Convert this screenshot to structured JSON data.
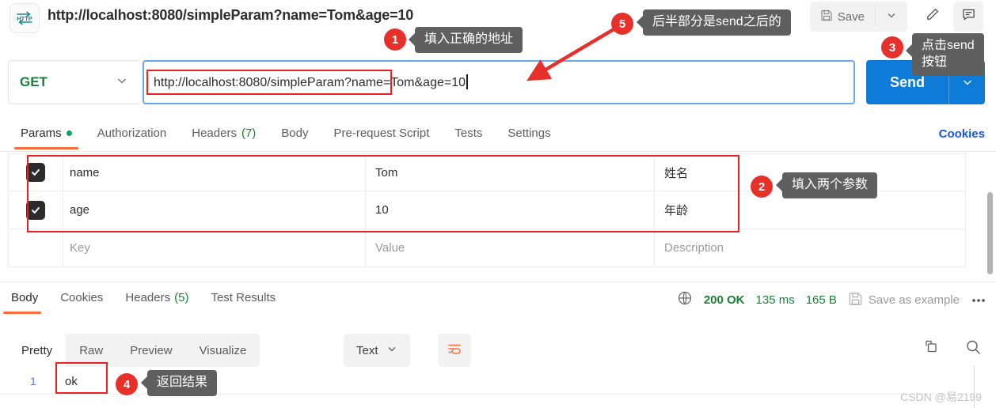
{
  "titlebar": {
    "logo_icon": "http-icon",
    "tab_title": "http://localhost:8080/simpleParam?name=Tom&age=10",
    "save_label": "Save",
    "save_icon": "floppy-disk-icon",
    "save_caret_icon": "chevron-down-icon",
    "pencil_icon": "pencil-icon",
    "comment_icon": "comment-icon"
  },
  "request": {
    "method": "GET",
    "method_caret_icon": "chevron-down-icon",
    "url": "http://localhost:8080/simpleParam?name=Tom&age=10",
    "url_highlight": "http://localhost:8080/simpleParam",
    "send_label": "Send",
    "send_caret_icon": "chevron-down-icon"
  },
  "request_tabs": {
    "items": [
      {
        "label": "Params",
        "active": true,
        "dot": true
      },
      {
        "label": "Authorization",
        "active": false
      },
      {
        "label": "Headers",
        "active": false,
        "count": "(7)"
      },
      {
        "label": "Body",
        "active": false
      },
      {
        "label": "Pre-request Script",
        "active": false
      },
      {
        "label": "Tests",
        "active": false
      },
      {
        "label": "Settings",
        "active": false
      }
    ],
    "cookies_link": "Cookies"
  },
  "params_table": {
    "headers": {
      "key": "Key",
      "value": "Value",
      "description": "Description"
    },
    "rows": [
      {
        "checked": true,
        "key": "name",
        "value": "Tom",
        "description": "姓名"
      },
      {
        "checked": true,
        "key": "age",
        "value": "10",
        "description": "年龄"
      }
    ],
    "placeholder_row": {
      "key": "Key",
      "value": "Value",
      "description": "Description"
    }
  },
  "response_tabs": {
    "items": [
      {
        "label": "Body",
        "active": true
      },
      {
        "label": "Cookies",
        "active": false
      },
      {
        "label": "Headers",
        "active": false,
        "count": "(5)"
      },
      {
        "label": "Test Results",
        "active": false
      }
    ],
    "globe_icon": "globe-icon",
    "status": "200 OK",
    "time": "135 ms",
    "size": "165 B",
    "save_example_label": "Save as example",
    "save_example_icon": "floppy-disk-icon",
    "more_icon": "ellipsis-icon"
  },
  "response_toolbar": {
    "views": [
      {
        "label": "Pretty",
        "active": true
      },
      {
        "label": "Raw",
        "active": false
      },
      {
        "label": "Preview",
        "active": false
      },
      {
        "label": "Visualize",
        "active": false
      }
    ],
    "format": "Text",
    "format_caret_icon": "chevron-down-icon",
    "wrap_icon": "wrap-lines-icon",
    "copy_icon": "copy-icon",
    "search_icon": "search-icon"
  },
  "response_body": {
    "line_number": "1",
    "content": "ok"
  },
  "watermark": "CSDN @易2199",
  "annotations": {
    "colors": {
      "badge": "#e8302a",
      "tooltip": "#5f5f5f",
      "highlight_box": "#f02020",
      "accent": "#ff6c37",
      "send": "#0f7bd8"
    },
    "items": [
      {
        "number": "1",
        "text": "填入正确的地址"
      },
      {
        "number": "2",
        "text": "填入两个参数"
      },
      {
        "number": "3",
        "text": "点击send",
        "text2": "按钮"
      },
      {
        "number": "4",
        "text": "返回结果"
      },
      {
        "number": "5",
        "text": "后半部分是send之后的"
      }
    ]
  }
}
